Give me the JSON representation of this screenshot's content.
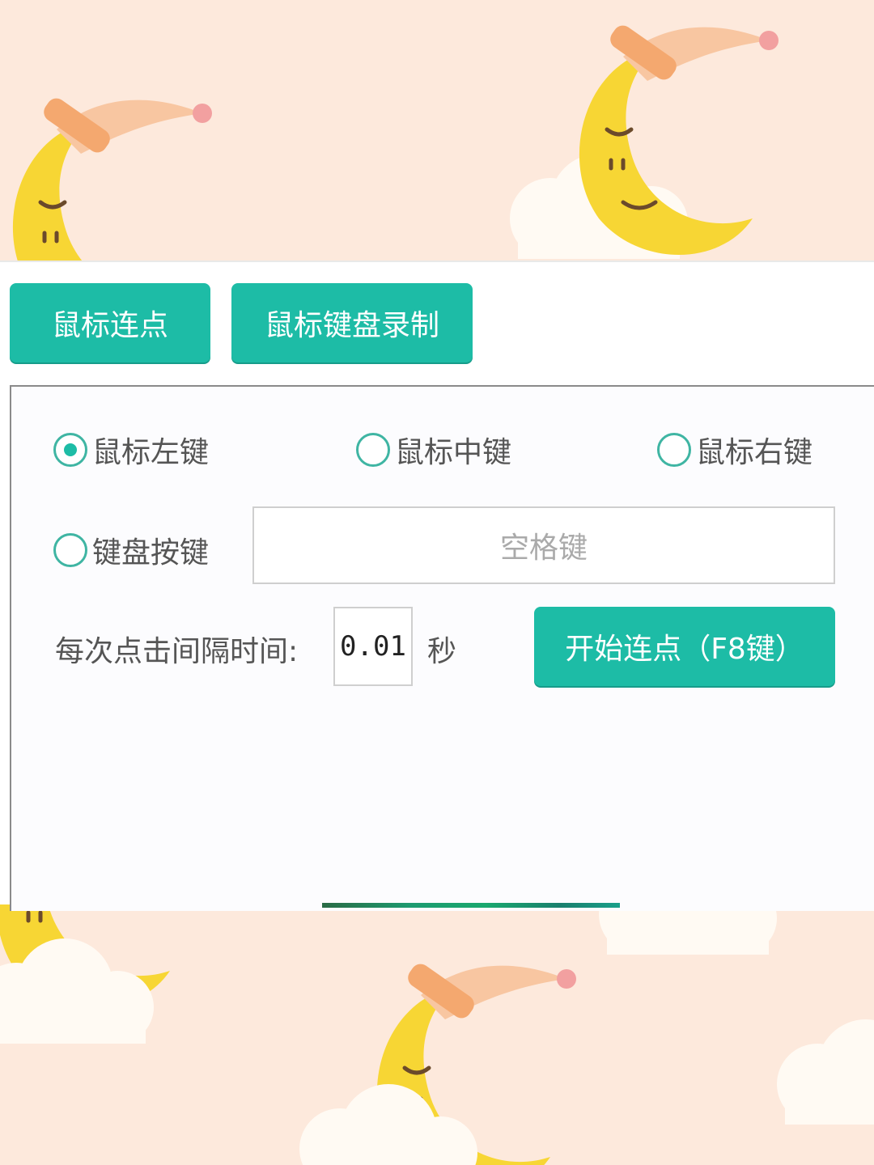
{
  "tabs": [
    {
      "label": "鼠标连点"
    },
    {
      "label": "鼠标键盘录制"
    }
  ],
  "click_options": [
    {
      "label": "鼠标左键",
      "selected": true
    },
    {
      "label": "鼠标中键",
      "selected": false
    },
    {
      "label": "鼠标右键",
      "selected": false
    },
    {
      "label": "键盘按键",
      "selected": false
    }
  ],
  "key_field": {
    "value": "空格键"
  },
  "interval": {
    "label": "每次点击间隔时间:",
    "value": "0.01",
    "unit": "秒"
  },
  "start_button": {
    "label": "开始连点（F8键）"
  },
  "colors": {
    "accent": "#1dbca6",
    "background": "#fde9dc",
    "moon": "#f7d634",
    "cap": "#f8c6a1"
  }
}
